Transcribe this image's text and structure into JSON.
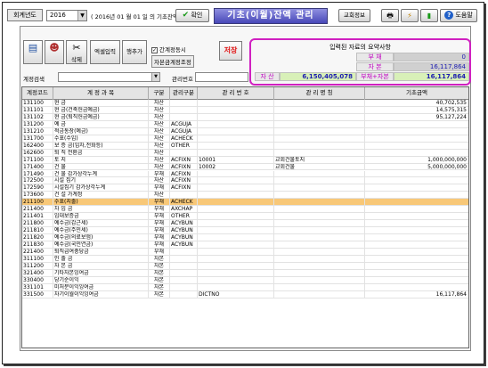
{
  "header": {
    "year_label": "회계년도",
    "year_value": "2016",
    "basis_text": "( 2016년 01 월 01 일 의 기초잔액 )",
    "confirm_label": "확인",
    "title": "기초(이월)잔액 관리",
    "church_info_label": "교회정보",
    "help_label": "도움말"
  },
  "toolbar": {
    "delete_label": "삭제",
    "excel_label": "엑셀입력",
    "add_row_label": "행추가",
    "check_interlock_label": "간계정동시",
    "check_interlock_checked": true,
    "self_adjust_label": "자본금계정조정",
    "save_label": "저장"
  },
  "summary": {
    "title": "입력된 자료의 요약사항",
    "debt_label": "부 채",
    "debt_value": "0",
    "capital_label": "자 본",
    "capital_value": "16,117,864",
    "asset_label": "자 산",
    "asset_value": "6,150,405,078",
    "debt_capital_label": "부채+자본",
    "debt_capital_value": "16,117,864"
  },
  "search": {
    "account_search_label": "계정검색",
    "mgmt_no_label": "관리번호"
  },
  "grid": {
    "columns": [
      "계정코드",
      "계  정  과  목",
      "구분",
      "관리구분",
      "관 리 번 호",
      "관 리 명 칭",
      "기초금액"
    ],
    "rows": [
      [
        "131100",
        "현        금",
        "자산",
        "",
        "",
        "",
        "40,702,535"
      ],
      [
        "131101",
        "현 금(건축헌금예금)",
        "자산",
        "",
        "",
        "",
        "14,575,315"
      ],
      [
        "131102",
        "현 금(퇴직헌금예금)",
        "자산",
        "",
        "",
        "",
        "95,127,224"
      ],
      [
        "131200",
        "예        금",
        "자산",
        "ACGUJA",
        "",
        "",
        ""
      ],
      [
        "131210",
        "적금통장(예금)",
        "자산",
        "ACGUJA",
        "",
        "",
        ""
      ],
      [
        "131700",
        "수표(수입)",
        "자산",
        "ACHECK",
        "",
        "",
        ""
      ],
      [
        "162400",
        "보 증 금(임차,전화등)",
        "자산",
        "OTHER",
        "",
        "",
        ""
      ],
      [
        "162600",
        "퇴 직 전환금",
        "자산",
        "",
        "",
        "",
        ""
      ],
      [
        "171100",
        "토        지",
        "자산",
        "ACFIXN",
        "10001",
        "교회건물토지",
        "1,000,000,000"
      ],
      [
        "171400",
        "건        물",
        "자산",
        "ACFIXN",
        "10002",
        "교회건물",
        "5,000,000,000"
      ],
      [
        "171490",
        "건 물 감가상각누계",
        "부채",
        "ACFIXN",
        "",
        "",
        ""
      ],
      [
        "172500",
        "시설 집기",
        "자산",
        "ACFIXN",
        "",
        "",
        ""
      ],
      [
        "172590",
        "시설집기 감가상각누계",
        "부채",
        "ACFIXN",
        "",
        "",
        ""
      ],
      [
        "173600",
        "건 설 가계정",
        "자산",
        "",
        "",
        "",
        ""
      ],
      [
        "211100",
        "수표(지출)",
        "부채",
        "ACHECK",
        "",
        "",
        ""
      ],
      [
        "211400",
        "차 입 금",
        "부채",
        "AXCHAP",
        "",
        "",
        ""
      ],
      [
        "211401",
        "임대보증금",
        "부채",
        "OTHER",
        "",
        "",
        ""
      ],
      [
        "211800",
        "예수금(갑근세)",
        "부채",
        "ACYBUN",
        "",
        "",
        ""
      ],
      [
        "211810",
        "예수금(주민세)",
        "부채",
        "ACYBUN",
        "",
        "",
        ""
      ],
      [
        "211820",
        "예수금(의료보험)",
        "부채",
        "ACYBUN",
        "",
        "",
        ""
      ],
      [
        "211830",
        "예수금(국민연금)",
        "부채",
        "ACYBUN",
        "",
        "",
        ""
      ],
      [
        "221400",
        "퇴직급여충당금",
        "부채",
        "",
        "",
        "",
        ""
      ],
      [
        "311100",
        "인   출   금",
        "자본",
        "",
        "",
        "",
        ""
      ],
      [
        "311200",
        "자   본   금",
        "자본",
        "",
        "",
        "",
        ""
      ],
      [
        "321400",
        "기타자본잉여금",
        "자본",
        "",
        "",
        "",
        ""
      ],
      [
        "330400",
        "당기순이익",
        "자본",
        "",
        "",
        "",
        ""
      ],
      [
        "331101",
        "미처분이익잉여금",
        "자본",
        "",
        "",
        "",
        ""
      ],
      [
        "331500",
        "차기이월이익잉여금",
        "자본",
        "",
        "DICTNO",
        "",
        "16,117,864"
      ]
    ],
    "selected_row": 14
  }
}
